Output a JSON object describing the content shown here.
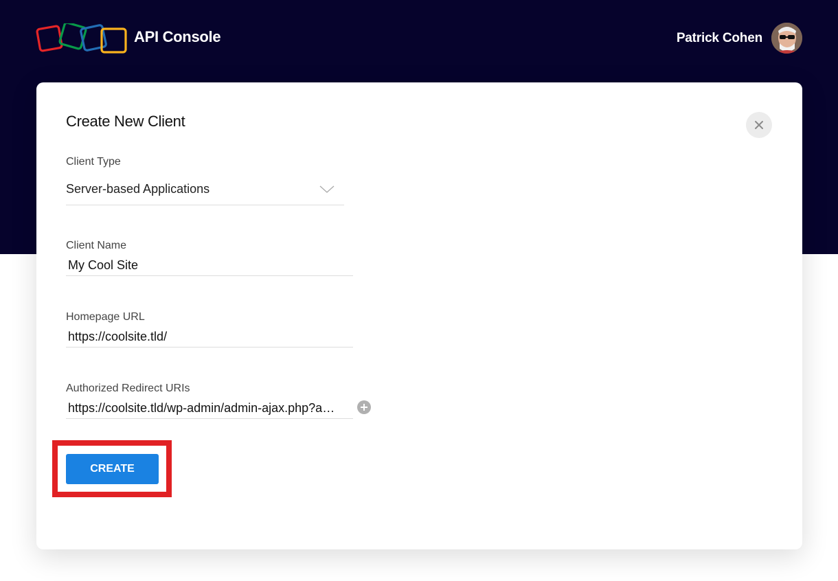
{
  "header": {
    "app_title": "API Console",
    "logo": {
      "icon": "zoho-logo-icon",
      "colors": [
        "#e42527",
        "#089949",
        "#226db4",
        "#f9b21d"
      ]
    },
    "user": {
      "name": "Patrick Cohen",
      "avatar_icon": "user-avatar"
    }
  },
  "dialog": {
    "title": "Create New Client",
    "close_icon": "close-icon",
    "client_type": {
      "label": "Client Type",
      "selected_value": "Server-based Applications",
      "icon": "chevron-down-icon"
    },
    "client_name": {
      "label": "Client Name",
      "value": "My Cool Site"
    },
    "homepage_url": {
      "label": "Homepage URL",
      "value": "https://coolsite.tld/"
    },
    "redirect_uris": {
      "label": "Authorized Redirect URIs",
      "value": "https://coolsite.tld/wp-admin/admin-ajax.php?a…",
      "add_icon": "plus-circle-icon"
    },
    "create_label": "CREATE"
  },
  "colors": {
    "header_bg": "#06032c",
    "primary_button": "#1a82e2",
    "highlight_border": "#e12124"
  }
}
